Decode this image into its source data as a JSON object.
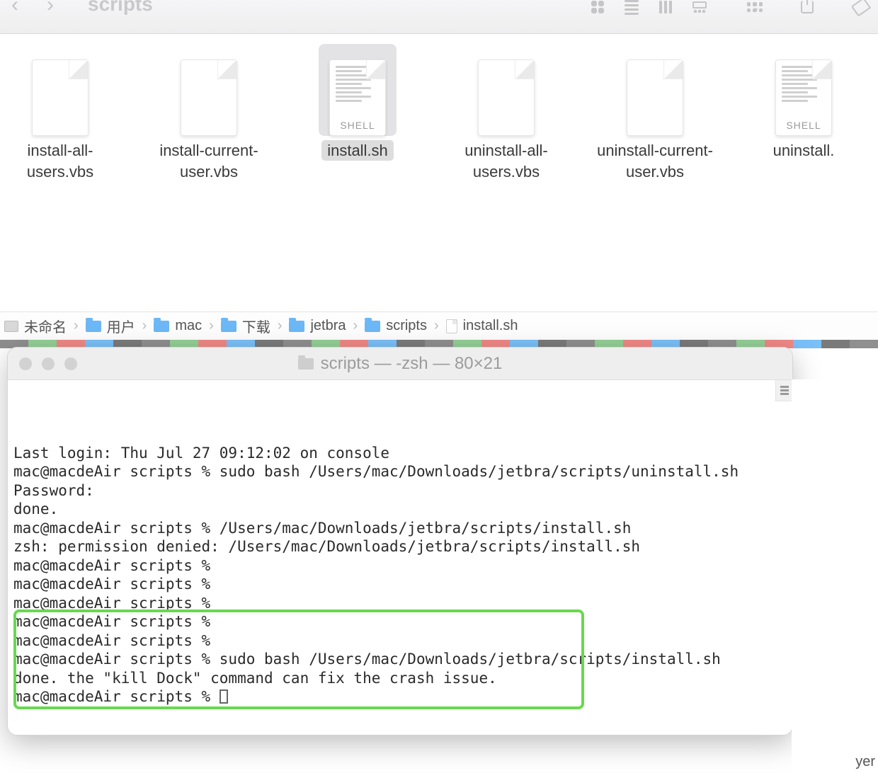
{
  "finder": {
    "title": "scripts",
    "files": [
      {
        "name": "install-all-users.vbs",
        "type": "blank",
        "selected": false
      },
      {
        "name": "install-current-user.vbs",
        "type": "blank",
        "selected": false
      },
      {
        "name": "install.sh",
        "type": "shell",
        "selected": true
      },
      {
        "name": "uninstall-all-users.vbs",
        "type": "blank",
        "selected": false
      },
      {
        "name": "uninstall-current-user.vbs",
        "type": "blank",
        "selected": false
      },
      {
        "name": "uninstall.",
        "type": "shell",
        "selected": false
      }
    ],
    "breadcrumb": [
      {
        "label": "未命名",
        "icon": "disk"
      },
      {
        "label": "用户",
        "icon": "folder"
      },
      {
        "label": "mac",
        "icon": "folder"
      },
      {
        "label": "下载",
        "icon": "folder"
      },
      {
        "label": "jetbra",
        "icon": "folder"
      },
      {
        "label": "scripts",
        "icon": "folder"
      },
      {
        "label": "install.sh",
        "icon": "doc"
      }
    ],
    "shell_badge": "SHELL"
  },
  "terminal": {
    "title": "scripts — -zsh — 80×21",
    "lines": [
      "Last login: Thu Jul 27 09:12:02 on console",
      "mac@macdeAir scripts % sudo bash /Users/mac/Downloads/jetbra/scripts/uninstall.sh",
      "Password:",
      "done.",
      "mac@macdeAir scripts % /Users/mac/Downloads/jetbra/scripts/install.sh",
      "zsh: permission denied: /Users/mac/Downloads/jetbra/scripts/install.sh",
      "mac@macdeAir scripts % ",
      "mac@macdeAir scripts % ",
      "mac@macdeAir scripts % ",
      "mac@macdeAir scripts % ",
      "mac@macdeAir scripts % ",
      "mac@macdeAir scripts % sudo bash /Users/mac/Downloads/jetbra/scripts/install.sh",
      "",
      "done. the \"kill Dock\" command can fix the crash issue.",
      "mac@macdeAir scripts % "
    ],
    "highlight_start_line": 11,
    "highlight_end_line": 14
  },
  "background_text": "yer"
}
